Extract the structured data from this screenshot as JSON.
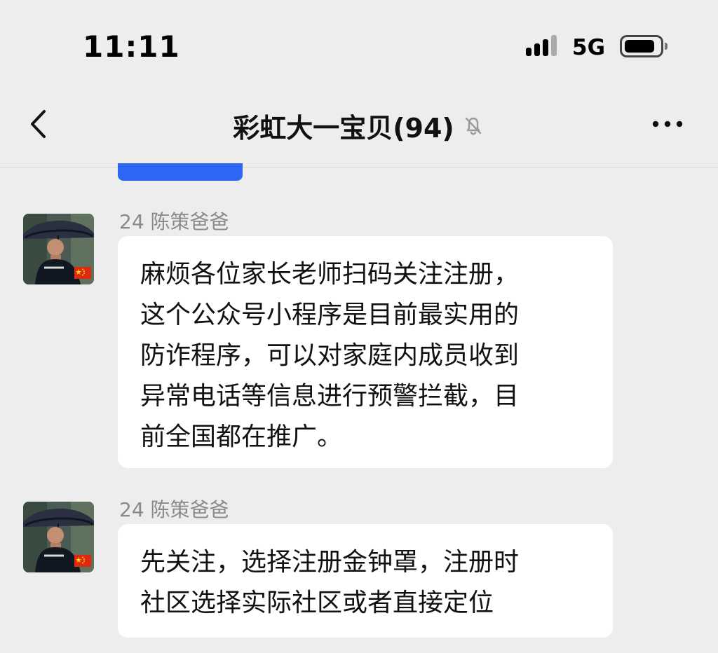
{
  "status_bar": {
    "time": "11:11",
    "network": "5G"
  },
  "header": {
    "title": "彩虹大一宝贝(94)"
  },
  "messages": [
    {
      "sender": "24 陈策爸爸",
      "lines": [
        "麻烦各位家长老师扫码关注注册，",
        "这个公众号小程序是目前最实用的",
        "防诈程序，可以对家庭内成员收到",
        "异常电话等信息进行预警拦截，目",
        "前全国都在推广。"
      ]
    },
    {
      "sender": "24 陈策爸爸",
      "lines": [
        "先关注，选择注册金钟罩，注册时",
        "社区选择实际社区或者直接定位"
      ]
    }
  ],
  "colors": {
    "background": "#ededed",
    "bubble": "#ffffff",
    "sender_name": "#8a8a8a",
    "previous_bubble": "#2f67f5"
  },
  "icons": {
    "back": "chevron-left-icon",
    "mute": "bell-slash-icon",
    "more": "more-dots-icon",
    "flag": "china-flag-icon"
  }
}
